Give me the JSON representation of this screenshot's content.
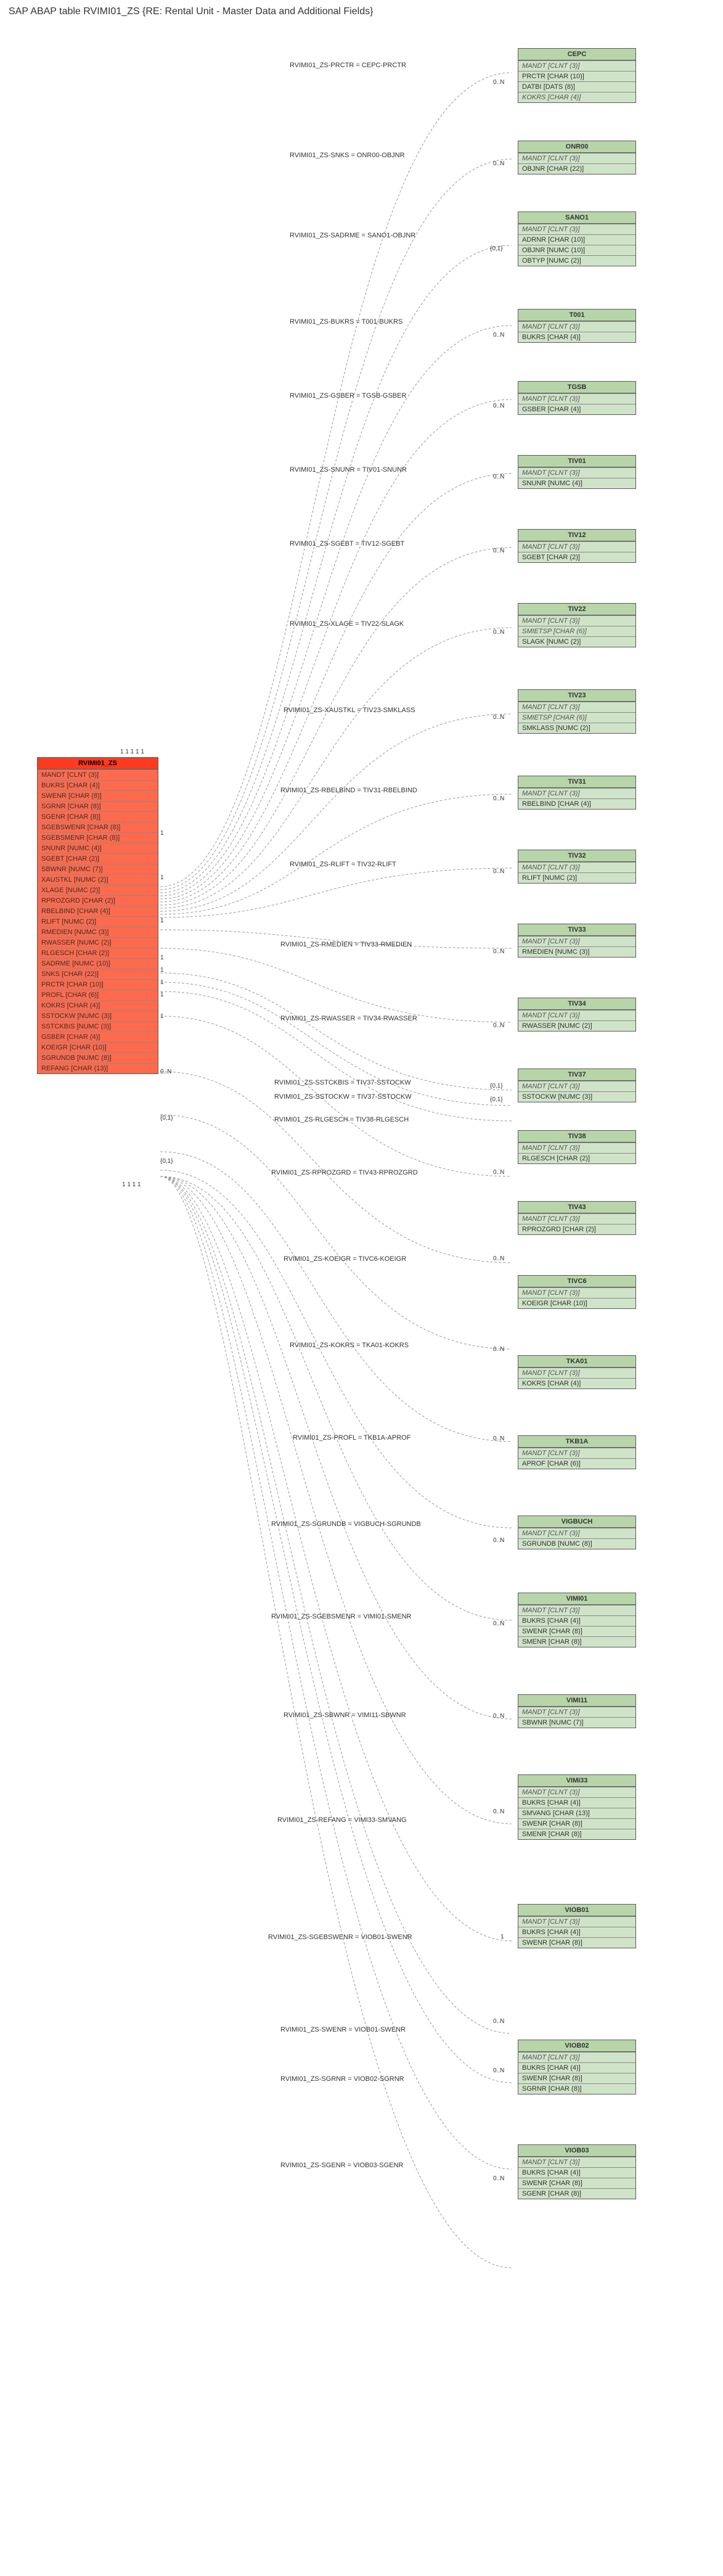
{
  "title": "SAP ABAP table RVIMI01_ZS {RE: Rental Unit - Master Data and Additional Fields}",
  "main_table": {
    "name": "RVIMI01_ZS",
    "fields": [
      "MANDT [CLNT (3)]",
      "BUKRS [CHAR (4)]",
      "SWENR [CHAR (8)]",
      "SGRNR [CHAR (8)]",
      "SGENR [CHAR (8)]",
      "SGEBSWENR [CHAR (8)]",
      "SGEBSMENR [CHAR (8)]",
      "SNUNR [NUMC (4)]",
      "SGEBT [CHAR (2)]",
      "SBWNR [NUMC (7)]",
      "XAUSTKL [NUMC (2)]",
      "XLAGE [NUMC (2)]",
      "RPROZGRD [CHAR (2)]",
      "RBELBIND [CHAR (4)]",
      "RLIFT [NUMC (2)]",
      "RMEDIEN [NUMC (3)]",
      "RWASSER [NUMC (2)]",
      "RLGESCH [CHAR (2)]",
      "SADRME [NUMC (10)]",
      "SNKS [CHAR (22)]",
      "PRCTR [CHAR (10)]",
      "PROFL [CHAR (6)]",
      "KOKRS [CHAR (4)]",
      "SSTOCKW [NUMC (3)]",
      "SSTCKBIS [NUMC (3)]",
      "GSBER [CHAR (4)]",
      "KOEIGR [CHAR (10)]",
      "SGRUNDB [NUMC (8)]",
      "REFANG [CHAR (13)]"
    ]
  },
  "relations": [
    {
      "label": "RVIMI01_ZS-PRCTR = CEPC-PRCTR",
      "card": "0..N",
      "table": "CEPC",
      "fields": [
        "MANDT [CLNT (3)]",
        "PRCTR [CHAR (10)]",
        "DATBI [DATS (8)]",
        "KOKRS [CHAR (4)]"
      ]
    },
    {
      "label": "RVIMI01_ZS-SNKS = ONR00-OBJNR",
      "card": "0..N",
      "table": "ONR00",
      "fields": [
        "MANDT [CLNT (3)]",
        "OBJNR [CHAR (22)]"
      ]
    },
    {
      "label": "RVIMI01_ZS-SADRME = SANO1-OBJNR",
      "card": "{0,1}",
      "table": "SANO1",
      "fields": [
        "MANDT [CLNT (3)]",
        "ADRNR [CHAR (10)]",
        "OBJNR [NUMC (10)]",
        "OBTYP [NUMC (2)]"
      ]
    },
    {
      "label": "RVIMI01_ZS-BUKRS = T001-BUKRS",
      "card": "0..N",
      "table": "T001",
      "fields": [
        "MANDT [CLNT (3)]",
        "BUKRS [CHAR (4)]"
      ]
    },
    {
      "label": "RVIMI01_ZS-GSBER = TGSB-GSBER",
      "card": "0..N",
      "table": "TGSB",
      "fields": [
        "MANDT [CLNT (3)]",
        "GSBER [CHAR (4)]"
      ]
    },
    {
      "label": "RVIMI01_ZS-SNUNR = TIV01-SNUNR",
      "card": "0..N",
      "table": "TIV01",
      "fields": [
        "MANDT [CLNT (3)]",
        "SNUNR [NUMC (4)]"
      ]
    },
    {
      "label": "RVIMI01_ZS-SGEBT = TIV12-SGEBT",
      "card": "0..N",
      "table": "TIV12",
      "fields": [
        "MANDT [CLNT (3)]",
        "SGEBT [CHAR (2)]"
      ]
    },
    {
      "label": "RVIMI01_ZS-XLAGE = TIV22-SLAGK",
      "card": "0..N",
      "table": "TIV22",
      "fields": [
        "MANDT [CLNT (3)]",
        "SMIETSP [CHAR (6)]",
        "SLAGK [NUMC (2)]"
      ]
    },
    {
      "label": "RVIMI01_ZS-XAUSTKL = TIV23-SMKLASS",
      "card": "0..N",
      "table": "TIV23",
      "fields": [
        "MANDT [CLNT (3)]",
        "SMIETSP [CHAR (6)]",
        "SMKLASS [NUMC (2)]"
      ]
    },
    {
      "label": "RVIMI01_ZS-RBELBIND = TIV31-RBELBIND",
      "card": "0..N",
      "table": "TIV31",
      "fields": [
        "MANDT [CLNT (3)]",
        "RBELBIND [CHAR (4)]"
      ]
    },
    {
      "label": "RVIMI01_ZS-RLIFT = TIV32-RLIFT",
      "card": "0..N",
      "table": "TIV32",
      "fields": [
        "MANDT [CLNT (3)]",
        "RLIFT [NUMC (2)]"
      ]
    },
    {
      "label": "RVIMI01_ZS-RMEDIEN = TIV33-RMEDIEN",
      "card": "0..N",
      "table": "TIV33",
      "fields": [
        "MANDT [CLNT (3)]",
        "RMEDIEN [NUMC (3)]"
      ]
    },
    {
      "label": "RVIMI01_ZS-RWASSER = TIV34-RWASSER",
      "card": "0..N",
      "table": "TIV34",
      "fields": [
        "MANDT [CLNT (3)]",
        "RWASSER [NUMC (2)]"
      ]
    },
    {
      "label": "RVIMI01_ZS-SSTCKBIS = TIV37-SSTOCKW",
      "card": "{0,1}",
      "table": "TIV37",
      "fields": [
        "MANDT [CLNT (3)]",
        "SSTOCKW [NUMC (3)]"
      ]
    },
    {
      "label": "RVIMI01_ZS-SSTOCKW = TIV37-SSTOCKW",
      "card": "{0,1}",
      "table": "",
      "fields": []
    },
    {
      "label": "RVIMI01_ZS-RLGESCH = TIV38-RLGESCH",
      "card": "",
      "table": "TIV38",
      "fields": [
        "MANDT [CLNT (3)]",
        "RLGESCH [CHAR (2)]"
      ]
    },
    {
      "label": "RVIMI01_ZS-RPROZGRD = TIV43-RPROZGRD",
      "card": "0..N",
      "table": "TIV43",
      "fields": [
        "MANDT [CLNT (3)]",
        "RPROZGRD [CHAR (2)]"
      ]
    },
    {
      "label": "RVIMI01_ZS-KOEIGR = TIVC6-KOEIGR",
      "card": "0..N",
      "table": "TIVC6",
      "fields": [
        "MANDT [CLNT (3)]",
        "KOEIGR [CHAR (10)]"
      ]
    },
    {
      "label": "RVIMI01_ZS-KOKRS = TKA01-KOKRS",
      "card": "0..N",
      "table": "TKA01",
      "fields": [
        "MANDT [CLNT (3)]",
        "KOKRS [CHAR (4)]"
      ]
    },
    {
      "label": "RVIMI01_ZS-PROFL = TKB1A-APROF",
      "card": "0..N",
      "table": "TKB1A",
      "fields": [
        "MANDT [CLNT (3)]",
        "APROF [CHAR (6)]"
      ]
    },
    {
      "label": "RVIMI01_ZS-SGRUNDB = VIGBUCH-SGRUNDB",
      "card": "0..N",
      "table": "VIGBUCH",
      "fields": [
        "MANDT [CLNT (3)]",
        "SGRUNDB [NUMC (8)]"
      ]
    },
    {
      "label": "RVIMI01_ZS-SGEBSMENR = VIMI01-SMENR",
      "card": "0..N",
      "table": "VIMI01",
      "fields": [
        "MANDT [CLNT (3)]",
        "BUKRS [CHAR (4)]",
        "SWENR [CHAR (8)]",
        "SMENR [CHAR (8)]"
      ]
    },
    {
      "label": "RVIMI01_ZS-SBWNR = VIMI11-SBWNR",
      "card": "0..N",
      "table": "VIMI11",
      "fields": [
        "MANDT [CLNT (3)]",
        "SBWNR [NUMC (7)]"
      ]
    },
    {
      "label": "RVIMI01_ZS-REFANG = VIMI33-SMVANG",
      "card": "0..N",
      "table": "VIMI33",
      "fields": [
        "MANDT [CLNT (3)]",
        "BUKRS [CHAR (4)]",
        "SMVANG [CHAR (13)]",
        "SWENR [CHAR (8)]",
        "SMENR [CHAR (8)]"
      ]
    },
    {
      "label": "RVIMI01_ZS-SGEBSWENR = VIOB01-SWENR",
      "card": "1",
      "table": "VIOB01",
      "fields": [
        "MANDT [CLNT (3)]",
        "BUKRS [CHAR (4)]",
        "SWENR [CHAR (8)]"
      ]
    },
    {
      "label": "RVIMI01_ZS-SWENR = VIOB01-SWENR",
      "card": "0..N",
      "table": "",
      "fields": []
    },
    {
      "label": "RVIMI01_ZS-SGRNR = VIOB02-SGRNR",
      "card": "0..N",
      "table": "VIOB02",
      "fields": [
        "MANDT [CLNT (3)]",
        "BUKRS [CHAR (4)]",
        "SWENR [CHAR (8)]",
        "SGRNR [CHAR (8)]"
      ]
    },
    {
      "label": "RVIMI01_ZS-SGENR = VIOB03-SGENR",
      "card": "0..N",
      "table": "VIOB03",
      "fields": [
        "MANDT [CLNT (3)]",
        "BUKRS [CHAR (4)]",
        "SWENR [CHAR (8)]",
        "SGENR [CHAR (8)]"
      ]
    }
  ],
  "left_multiplicities": {
    "cluster_top": "1 1 1  1  1",
    "cluster_bottom": "1 1 1  1",
    "near_main": [
      "1",
      "1",
      "1",
      "1",
      "1",
      "1",
      "1",
      "1",
      "0..N",
      "{0,1}",
      "{0,1}"
    ]
  }
}
